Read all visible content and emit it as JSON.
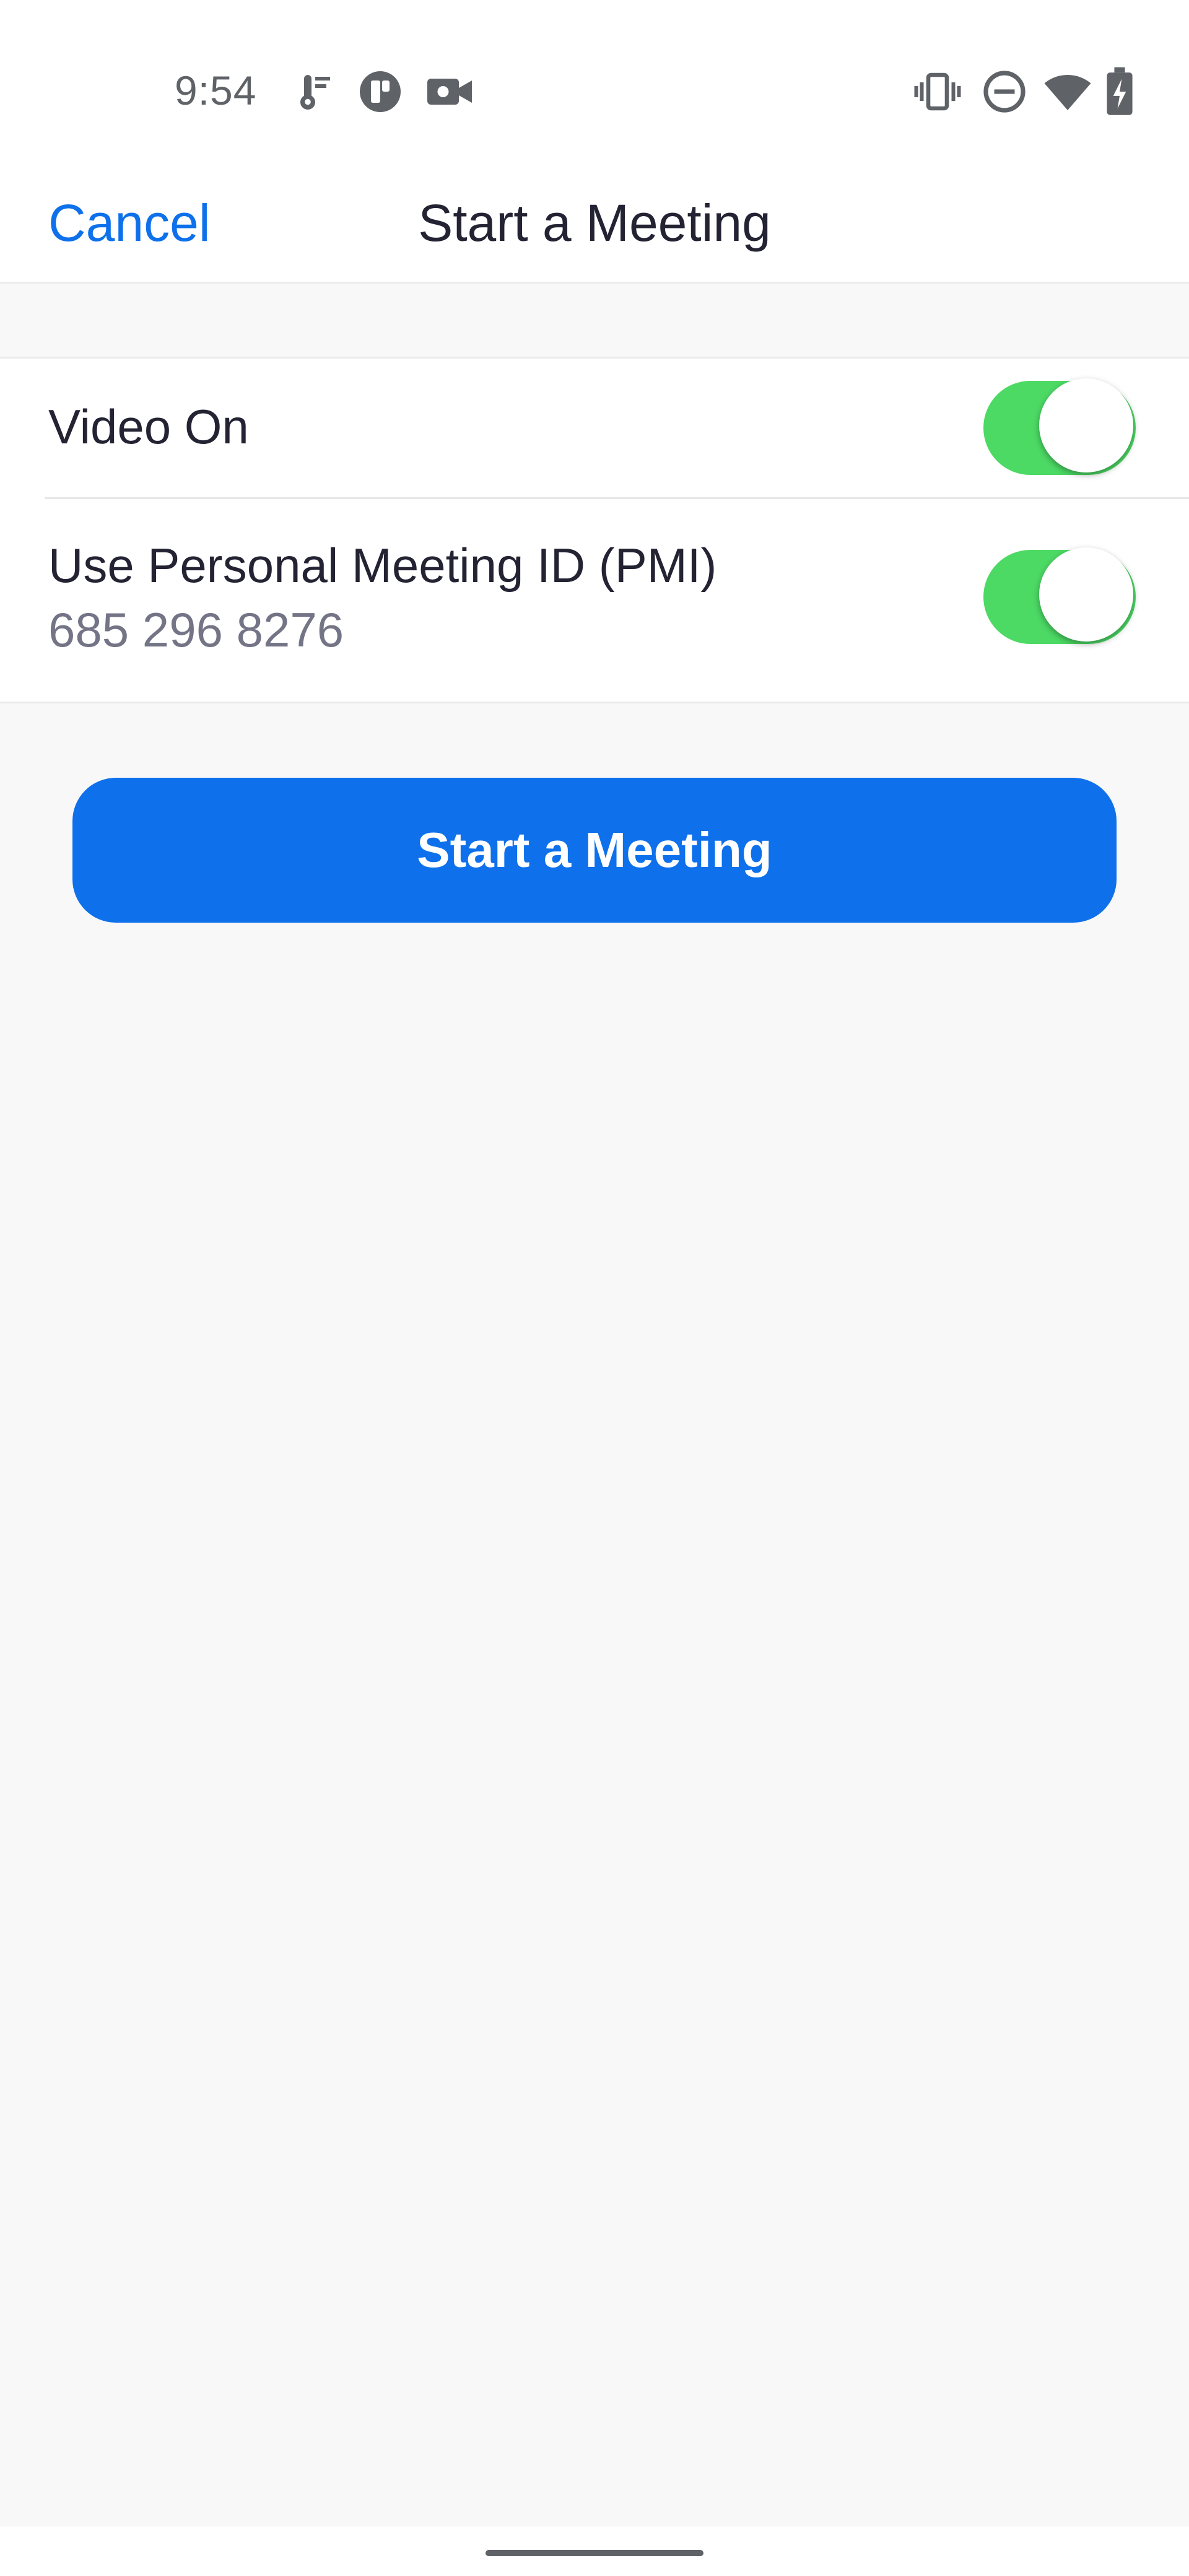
{
  "status_bar": {
    "time": "9:54",
    "left_icons": [
      "thermometer-icon",
      "app-notification-icon",
      "video-camera-icon"
    ],
    "right_icons": [
      "vibrate-icon",
      "do-not-disturb-icon",
      "wifi-icon",
      "battery-charging-icon"
    ]
  },
  "nav": {
    "cancel_label": "Cancel",
    "title": "Start a Meeting"
  },
  "settings": {
    "video_on": {
      "label": "Video On",
      "enabled": true
    },
    "pmi": {
      "label": "Use Personal Meeting ID (PMI)",
      "meeting_id": "685 296 8276",
      "enabled": true
    }
  },
  "actions": {
    "start_label": "Start a Meeting"
  },
  "colors": {
    "accent": "#0e71eb",
    "toggle_on": "#4cd964",
    "background": "#f8f8f8",
    "text_primary": "#232333",
    "text_secondary": "#747487"
  }
}
